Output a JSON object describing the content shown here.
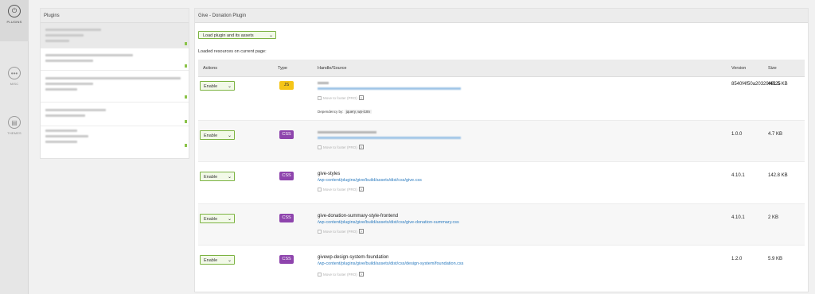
{
  "nav": {
    "items": [
      {
        "label": "PLUGINS",
        "icon": "plug-icon"
      },
      {
        "label": "MISC",
        "icon": "dots-icon"
      },
      {
        "label": "THEMES",
        "icon": "brush-icon"
      }
    ]
  },
  "plugins_panel": {
    "title": "Plugins"
  },
  "main_panel": {
    "title": "Give - Donation Plugin",
    "load_select": "Load plugin and its assets",
    "loaded_label": "Loaded resources on current page:",
    "columns": {
      "actions": "Actions",
      "type": "Type",
      "handle": "Handle/Source",
      "version": "Version",
      "size": "Size"
    },
    "rows": [
      {
        "action": "Enable",
        "type": "JS",
        "handle": "",
        "src": "",
        "footer_opt": "Move to footer (PRO)",
        "dependency_label": "Dependency by:",
        "dependency_value": "jquery, wp-i18n",
        "version": "8540f4f50a20329f4525",
        "size": "461.5 KB"
      },
      {
        "action": "Enable",
        "type": "CSS",
        "handle": "",
        "src": "",
        "footer_opt": "Move to footer (PRO)",
        "version": "1.0.0",
        "size": "4.7 KB"
      },
      {
        "action": "Enable",
        "type": "CSS",
        "handle": "give-styles",
        "src": "/wp-content/plugins/give/build/assets/dist/css/give.css",
        "footer_opt": "Move to footer (PRO)",
        "version": "4.10.1",
        "size": "142.8 KB"
      },
      {
        "action": "Enable",
        "type": "CSS",
        "handle": "give-donation-summary-style-frontend",
        "src": "/wp-content/plugins/give/build/assets/dist/css/give-donation-summary.css",
        "footer_opt": "Move to footer (PRO)",
        "version": "4.10.1",
        "size": "2 KB"
      },
      {
        "action": "Enable",
        "type": "CSS",
        "handle": "givewp-design-system-foundation",
        "src": "/wp-content/plugins/give/build/assets/dist/css/design-system/foundation.css",
        "footer_opt": "Move to footer (PRO)",
        "version": "1.2.0",
        "size": "5.9 KB"
      }
    ]
  },
  "colors": {
    "accent_green": "#7cb342",
    "js_badge": "#f5c518",
    "css_badge": "#8e44ad",
    "link": "#2b7bbf"
  }
}
